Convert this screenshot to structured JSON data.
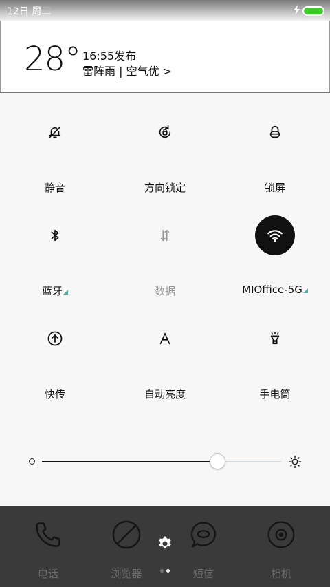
{
  "statusbar": {
    "date": "12日 周二",
    "battery_level": 1.0
  },
  "weather": {
    "temperature": "28°",
    "publish_time": "16:55发布",
    "description": "雷阵雨 | 空气优 >"
  },
  "tiles": [
    {
      "label": "静音",
      "icon": "bell-off-icon"
    },
    {
      "label": "方向锁定",
      "icon": "rotation-lock-icon"
    },
    {
      "label": "锁屏",
      "icon": "lock-icon"
    },
    {
      "label": "蓝牙",
      "icon": "bluetooth-icon"
    },
    {
      "label": "数据",
      "icon": "data-arrows-icon"
    },
    {
      "label": "MIOffice-5G",
      "icon": "wifi-icon"
    },
    {
      "label": "快传",
      "icon": "upload-circle-icon"
    },
    {
      "label": "自动亮度",
      "icon": "auto-brightness-icon"
    },
    {
      "label": "手电筒",
      "icon": "flashlight-icon"
    }
  ],
  "brightness": {
    "level": 0.73
  },
  "dock": {
    "apps": [
      {
        "label": "电话",
        "icon": "phone-icon"
      },
      {
        "label": "浏览器",
        "icon": "browser-icon"
      },
      {
        "label": "短信",
        "icon": "message-icon"
      },
      {
        "label": "相机",
        "icon": "camera-icon"
      }
    ],
    "page_count": 2,
    "current_page": 2
  },
  "colors": {
    "accent_triangle": "#47b5a9",
    "battery": "#3ecb2a",
    "dock_bg": "#3a3a3a"
  }
}
